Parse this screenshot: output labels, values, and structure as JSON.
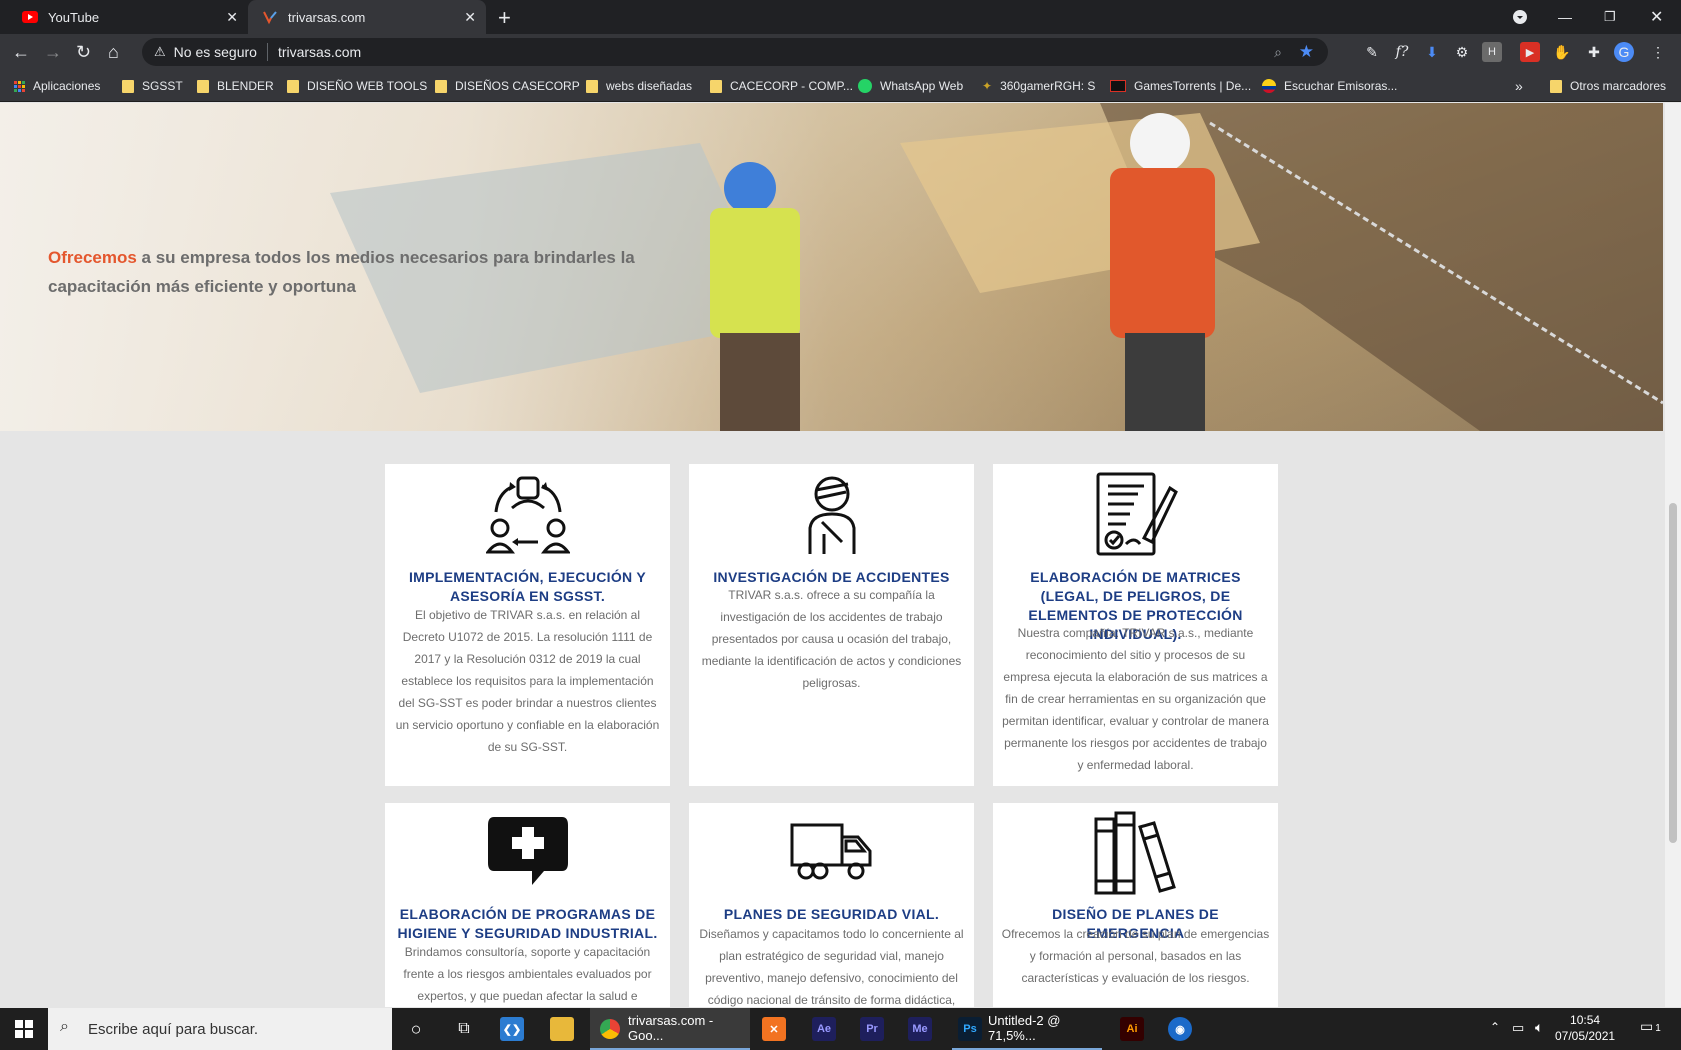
{
  "browser": {
    "tabs": [
      {
        "label": "YouTube"
      },
      {
        "label": "trivarsas.com"
      }
    ],
    "security_label": "No es seguro",
    "url": "trivarsas.com",
    "bookmarks": [
      {
        "label": "Aplicaciones"
      },
      {
        "label": "SGSST"
      },
      {
        "label": "BLENDER"
      },
      {
        "label": "DISEÑO WEB TOOLS"
      },
      {
        "label": "DISEÑOS CASECORP"
      },
      {
        "label": "webs diseñadas"
      },
      {
        "label": "CACECORP - COMP..."
      },
      {
        "label": "WhatsApp Web"
      },
      {
        "label": "360gamerRGH: S"
      },
      {
        "label": "GamesTorrents | De..."
      },
      {
        "label": "Escuchar Emisoras..."
      },
      {
        "label": "Otros marcadores"
      }
    ],
    "overflow_label": "»"
  },
  "hero": {
    "accent": "Ofrecemos",
    "text": " a su empresa todos los medios necesarios para brindarles la capacitación más eficiente y oportuna"
  },
  "cards": [
    {
      "icon": "team-cycle-icon",
      "title": "IMPLEMENTACIÓN, EJECUCIÓN Y ASESORÍA EN SGSST.",
      "body": "El objetivo de TRIVAR s.a.s. en relación al Decreto U1072 de 2015. La resolución 1111 de 2017 y la Resolución 0312 de 2019 la cual establece los requisitos para la implementación del SG-SST es poder brindar a nuestros clientes un servicio oportuno y confiable en la elaboración de su SG-SST."
    },
    {
      "icon": "injured-worker-icon",
      "title": "INVESTIGACIÓN DE ACCIDENTES",
      "body": "TRIVAR s.a.s. ofrece a su compañía la investigación de los accidentes de trabajo presentados por causa u ocasión del trabajo, mediante la identificación de actos y condiciones peligrosas."
    },
    {
      "icon": "contract-signature-icon",
      "title": "ELABORACIÓN DE MATRICES (LEGAL, DE PELIGROS, DE ELEMENTOS DE PROTECCIÓN INDIVIDUAL).",
      "body": "Nuestra compañía: TRIVAR s.a.s., mediante reconocimiento del sitio y procesos de su empresa ejecuta la elaboración de sus matrices a fin de crear herramientas en su organización que permitan identificar, evaluar y controlar de manera permanente los riesgos por accidentes de trabajo y enfermedad laboral."
    },
    {
      "icon": "medical-chat-icon",
      "title": "ELABORACIÓN DE PROGRAMAS DE HIGIENE Y SEGURIDAD INDUSTRIAL.",
      "body": "Brindamos consultoría, soporte y capacitación frente a los riesgos ambientales evaluados por expertos, y que puedan afectar la salud e"
    },
    {
      "icon": "truck-icon",
      "title": "PLANES DE SEGURIDAD VIAL.",
      "body": "Diseñamos y capacitamos todo lo concerniente al plan estratégico de seguridad vial, manejo preventivo, manejo defensivo, conocimiento del código nacional de tránsito de forma didáctica,"
    },
    {
      "icon": "binders-icon",
      "title": "DISEÑO DE PLANES DE EMERGENCIA",
      "body": "Ofrecemos la creación de su plan de emergencias y formación al personal, basados en las características y evaluación de los riesgos."
    }
  ],
  "taskbar": {
    "search_placeholder": "Escribe aquí para buscar.",
    "chrome_label": "trivarsas.com - Goo...",
    "ps_label": "Untitled-2 @ 71,5%...",
    "time": "10:54",
    "date": "07/05/2021",
    "notification_count": "1"
  },
  "colors": {
    "accent_orange": "#e4572e",
    "title_blue": "#1d3d84",
    "body_gray": "#6d6d6d"
  }
}
